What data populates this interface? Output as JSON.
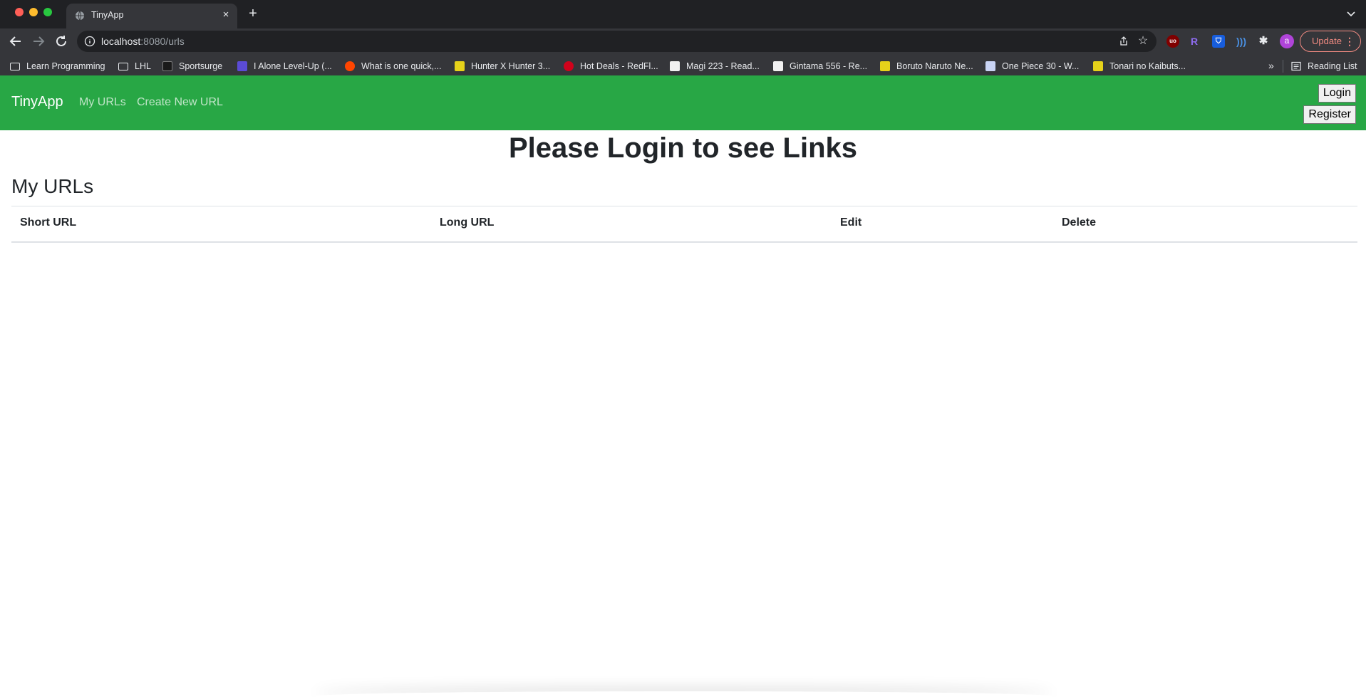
{
  "browser": {
    "tab_title": "TinyApp",
    "url_host": "localhost",
    "url_path": ":8080/urls",
    "update_label": "Update",
    "avatar_letter": "a",
    "bookmarks": [
      {
        "label": "Learn Programming",
        "icon": "folder-icon",
        "color": "#e8eaed"
      },
      {
        "label": "LHL",
        "icon": "folder-icon",
        "color": "#e8eaed"
      },
      {
        "label": "Sportsurge",
        "icon": "sportsurge-icon",
        "color": "#1a1a1a"
      },
      {
        "label": "I Alone Level-Up (...",
        "icon": "manga-site-icon",
        "color": "#5b4bd6"
      },
      {
        "label": "What is one quick,...",
        "icon": "reddit-icon",
        "color": "#ff4500"
      },
      {
        "label": "Hunter X Hunter 3...",
        "icon": "manga-yellow-icon",
        "color": "#e6d21a"
      },
      {
        "label": "Hot Deals - RedFl...",
        "icon": "redflagdeals-icon",
        "color": "#d0021b"
      },
      {
        "label": "Magi 223 - Read...",
        "icon": "manga-white-icon",
        "color": "#f1f1f1"
      },
      {
        "label": "Gintama 556 - Re...",
        "icon": "manga-white-icon",
        "color": "#f1f1f1"
      },
      {
        "label": "Boruto Naruto Ne...",
        "icon": "manga-yellow-icon",
        "color": "#e6d21a"
      },
      {
        "label": "One Piece 30 - W...",
        "icon": "manga-blue-icon",
        "color": "#c9d4f5"
      },
      {
        "label": "Tonari no Kaibuts...",
        "icon": "manga-yellow-icon",
        "color": "#e6d21a"
      }
    ],
    "reading_list_label": "Reading List"
  },
  "app": {
    "brand": "TinyApp",
    "nav_links": [
      "My URLs",
      "Create New URL"
    ],
    "login_label": "Login",
    "register_label": "Register",
    "headline": "Please Login to see Links",
    "section_title": "My URLs",
    "table_headers": [
      "Short URL",
      "Long URL",
      "Edit",
      "Delete"
    ],
    "navbar_color": "#28a745"
  }
}
